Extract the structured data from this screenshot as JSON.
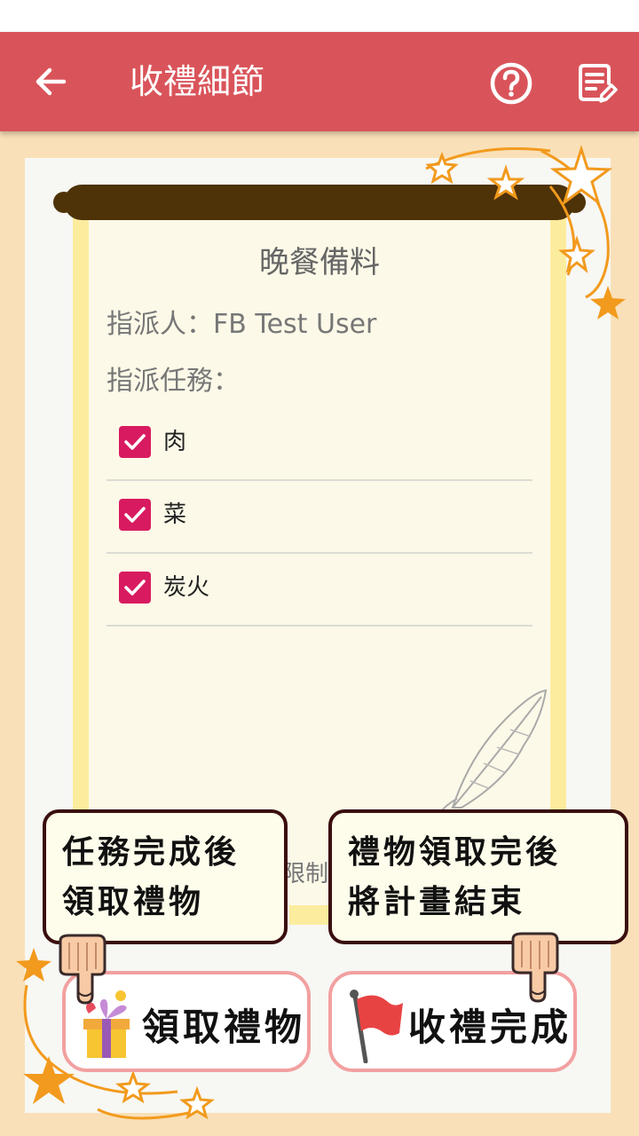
{
  "header": {
    "title": "收禮細節"
  },
  "task": {
    "title": "晚餐備料",
    "assigner": "指派人：FB Test User",
    "tasks_label": "指派任務：",
    "items": [
      {
        "label": "肉",
        "checked": true
      },
      {
        "label": "菜",
        "checked": true
      },
      {
        "label": "炭火",
        "checked": true
      }
    ],
    "partially_hidden_text": "限制"
  },
  "hints": {
    "claim_hint_line1": "任務完成後",
    "claim_hint_line2": "領取禮物",
    "finish_hint_line1": "禮物領取完後",
    "finish_hint_line2": "將計畫結束"
  },
  "actions": {
    "claim_label": "領取禮物",
    "finish_label": "收禮完成"
  },
  "colors": {
    "appbar": "#d9545a",
    "checkbox": "#d81b60",
    "background": "#f9e0b8",
    "button_border": "#f2a0a0"
  },
  "icons": {
    "back": "arrow-left-icon",
    "help": "help-circle-icon",
    "note": "note-edit-icon",
    "claim": "gift-icon",
    "finish": "red-flag-icon"
  }
}
